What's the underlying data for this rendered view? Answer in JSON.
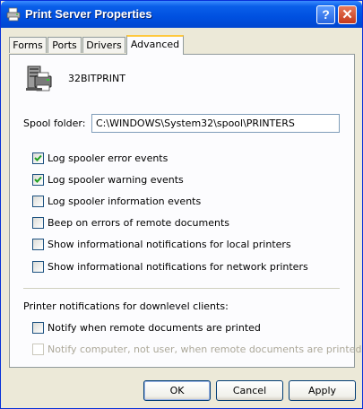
{
  "window": {
    "title": "Print Server Properties",
    "help_label": "?",
    "close_label": "✕"
  },
  "tabs": [
    {
      "label": "Forms",
      "active": false
    },
    {
      "label": "Ports",
      "active": false
    },
    {
      "label": "Drivers",
      "active": false
    },
    {
      "label": "Advanced",
      "active": true
    }
  ],
  "server": {
    "name": "32BITPRINT",
    "icon": "printer-server-icon"
  },
  "spool": {
    "label": "Spool folder:",
    "value": "C:\\WINDOWS\\System32\\spool\\PRINTERS"
  },
  "options": [
    {
      "label": "Log spooler error events",
      "checked": true,
      "enabled": true
    },
    {
      "label": "Log spooler warning events",
      "checked": true,
      "enabled": true
    },
    {
      "label": "Log spooler information events",
      "checked": false,
      "enabled": true
    },
    {
      "label": "Beep on errors of remote documents",
      "checked": false,
      "enabled": true
    },
    {
      "label": "Show informational notifications for local printers",
      "checked": false,
      "enabled": true
    },
    {
      "label": "Show informational notifications for network printers",
      "checked": false,
      "enabled": true
    }
  ],
  "downlevel": {
    "heading": "Printer notifications for downlevel clients:",
    "options": [
      {
        "label": "Notify when remote documents are printed",
        "checked": false,
        "enabled": true
      },
      {
        "label": "Notify computer, not user, when remote documents are printed",
        "checked": false,
        "enabled": false
      }
    ]
  },
  "buttons": {
    "ok": "OK",
    "cancel": "Cancel",
    "apply": "Apply"
  },
  "colors": {
    "titlebar": "#0050E0",
    "face": "#ECE9D8",
    "active_tab_accent": "#FFC83C",
    "check": "#21A121"
  }
}
